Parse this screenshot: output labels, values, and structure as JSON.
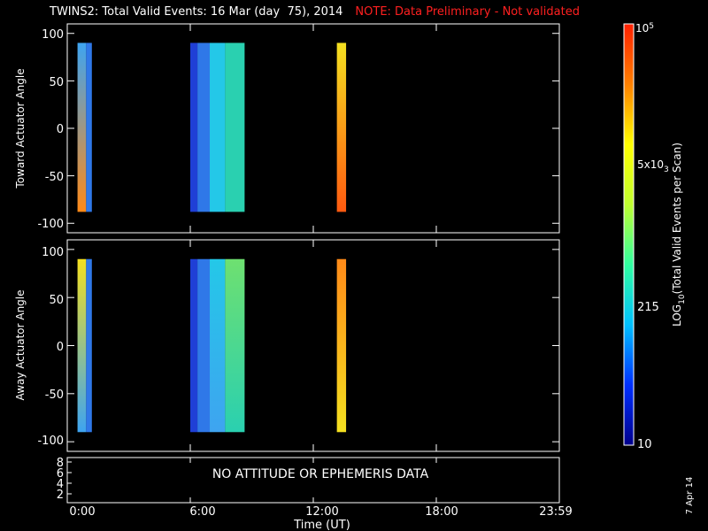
{
  "title": {
    "main": "TWINS2: Total Valid Events: 16 Mar (day  75), 2014",
    "note": "NOTE: Data Preliminary - Not validated"
  },
  "panels": {
    "top_ylabel": "Toward Actuator Angle",
    "bottom_ylabel": "Away Actuator Angle",
    "y_ticks": [
      "100",
      "50",
      "0",
      "-50",
      "-100"
    ],
    "attitude_ticks": [
      "8",
      "6",
      "4",
      "2"
    ],
    "no_data_message": "NO ATTITUDE OR EPHEMERIS DATA"
  },
  "x_axis": {
    "ticks": [
      "0:00",
      "6:00",
      "12:00",
      "18:00",
      "23:59"
    ],
    "label": "Time (UT)"
  },
  "colorbar": {
    "label": "LOG10(Total Valid  Events per Scan)",
    "tick_labels": [
      "10",
      "215",
      "5x10^3",
      "10^5"
    ],
    "colors": [
      "#00008c",
      "#0030ff",
      "#00c0ff",
      "#30ffa0",
      "#c0ff30",
      "#ffff00",
      "#ff8000",
      "#ff2000"
    ]
  },
  "date_stamp": "7 Apr 14",
  "colors": {
    "dark_blue": "#1f3fd6",
    "mid_blue": "#2f78e8",
    "sky": "#3ea4f0",
    "cyan": "#24c8e8",
    "teal": "#2ad0b0",
    "green": "#6ee070",
    "yellow": "#f4e020",
    "orange": "#ff8a18",
    "red_orange": "#ff5a10"
  },
  "chart_data": {
    "type": "heatmap",
    "x_unit": "hours UT",
    "xlim": [
      0,
      24
    ],
    "ylim": [
      -110,
      110
    ],
    "panels": [
      {
        "name": "Toward Actuator Angle",
        "blocks": [
          {
            "x0": 0.5,
            "x1": 0.92,
            "y0": -88,
            "y1": 90,
            "color_top": "sky",
            "color_bottom": "orange"
          },
          {
            "x0": 0.92,
            "x1": 1.2,
            "y0": -88,
            "y1": 90,
            "color_top": "mid_blue",
            "color_bottom": "mid_blue"
          },
          {
            "x0": 6.0,
            "x1": 6.35,
            "y0": -88,
            "y1": 90,
            "color_top": "dark_blue",
            "color_bottom": "dark_blue"
          },
          {
            "x0": 6.35,
            "x1": 6.95,
            "y0": -88,
            "y1": 90,
            "color_top": "mid_blue",
            "color_bottom": "mid_blue"
          },
          {
            "x0": 6.95,
            "x1": 7.7,
            "y0": -88,
            "y1": 90,
            "color_top": "cyan",
            "color_bottom": "cyan"
          },
          {
            "x0": 7.7,
            "x1": 8.65,
            "y0": -88,
            "y1": 90,
            "color_top": "teal",
            "color_bottom": "teal"
          },
          {
            "x0": 13.15,
            "x1": 13.6,
            "y0": -88,
            "y1": 90,
            "color_top": "yellow",
            "color_bottom": "red_orange"
          }
        ]
      },
      {
        "name": "Away Actuator Angle",
        "blocks": [
          {
            "x0": 0.5,
            "x1": 0.92,
            "y0": -90,
            "y1": 90,
            "color_top": "yellow",
            "color_bottom": "sky"
          },
          {
            "x0": 0.92,
            "x1": 1.2,
            "y0": -90,
            "y1": 90,
            "color_top": "mid_blue",
            "color_bottom": "mid_blue"
          },
          {
            "x0": 6.0,
            "x1": 6.35,
            "y0": -90,
            "y1": 90,
            "color_top": "dark_blue",
            "color_bottom": "dark_blue"
          },
          {
            "x0": 6.35,
            "x1": 6.95,
            "y0": -90,
            "y1": 90,
            "color_top": "mid_blue",
            "color_bottom": "mid_blue"
          },
          {
            "x0": 6.95,
            "x1": 7.7,
            "y0": -90,
            "y1": 90,
            "color_top": "cyan",
            "color_bottom": "sky"
          },
          {
            "x0": 7.7,
            "x1": 8.65,
            "y0": -90,
            "y1": 90,
            "color_top": "green",
            "color_bottom": "teal"
          },
          {
            "x0": 13.15,
            "x1": 13.6,
            "y0": -90,
            "y1": 90,
            "color_top": "orange",
            "color_bottom": "yellow"
          }
        ]
      }
    ]
  }
}
